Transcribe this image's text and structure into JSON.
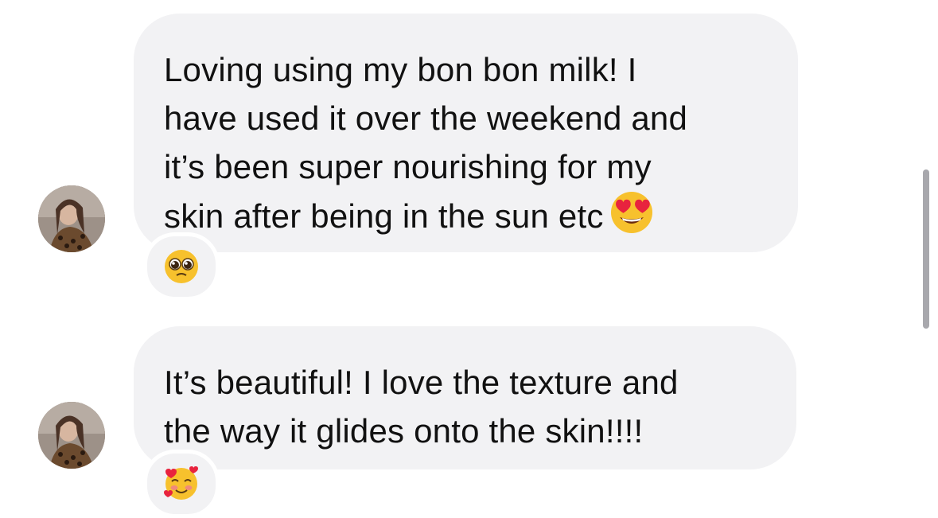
{
  "messages": [
    {
      "text_lines": "Loving using my bon bon milk! I\nhave used it over the weekend and\nit’s been super nourishing for my\nskin after being in the sun etc",
      "inline_emoji": "heart-eyes-emoji",
      "reaction": "pleading-face-emoji"
    },
    {
      "text_lines": "It’s beautiful! I love the texture and\nthe way it glides onto the skin!!!!",
      "reaction": "smiling-face-with-hearts-emoji"
    }
  ],
  "colors": {
    "bubble_bg": "#f2f2f4",
    "text": "#111111",
    "scrollbar": "#a8a8ad"
  }
}
